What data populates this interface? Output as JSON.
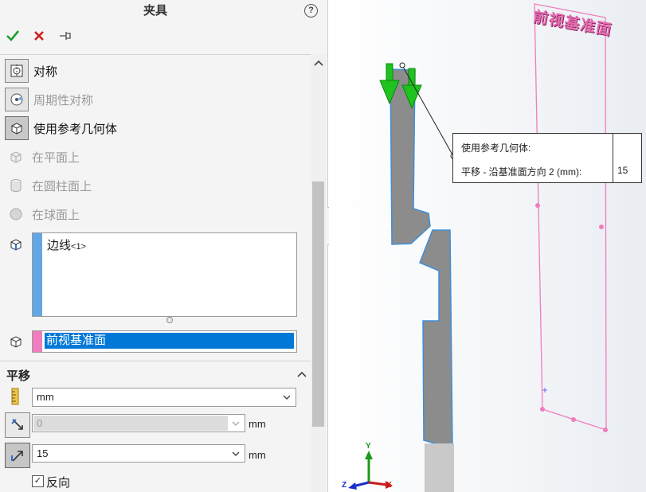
{
  "panel": {
    "title": "夹具",
    "help_label": "?",
    "actions": [
      {
        "name": "ok",
        "icon": "check-icon"
      },
      {
        "name": "cancel",
        "icon": "close-icon"
      },
      {
        "name": "pin",
        "icon": "pin-icon"
      }
    ]
  },
  "options": {
    "symmetric": "对称",
    "cyclic_symmetric": "周期性对称",
    "use_ref_geometry": "使用参考几何体",
    "on_flat_faces": "在平面上",
    "on_cylindrical_faces": "在圆柱面上",
    "on_spherical_faces": "在球面上"
  },
  "selection": {
    "entity": "边线",
    "entity_suffix": "<1>",
    "reference_plane": "前视基准面"
  },
  "translation": {
    "section_title": "平移",
    "units": "mm",
    "dir1_value": "0",
    "dir1_unit": "mm",
    "dir2_value": "15",
    "dir2_unit": "mm",
    "reverse_label": "反向",
    "reverse_checked": true
  },
  "callout": {
    "heading": "使用参考几何体:",
    "row_label": "平移 - 沿基准面方向 2 (mm):",
    "row_value": "15"
  },
  "viewport": {
    "plane_label": "前视基准面",
    "triad": {
      "x": "X",
      "y": "Y",
      "z": "Z"
    }
  },
  "colors": {
    "selection_blue": "#0078d7",
    "plane_pink": "#f07dbd",
    "edge_blue": "#63a6e6",
    "arrow_green": "#18c21a",
    "part_gray": "#8c8c8c"
  }
}
